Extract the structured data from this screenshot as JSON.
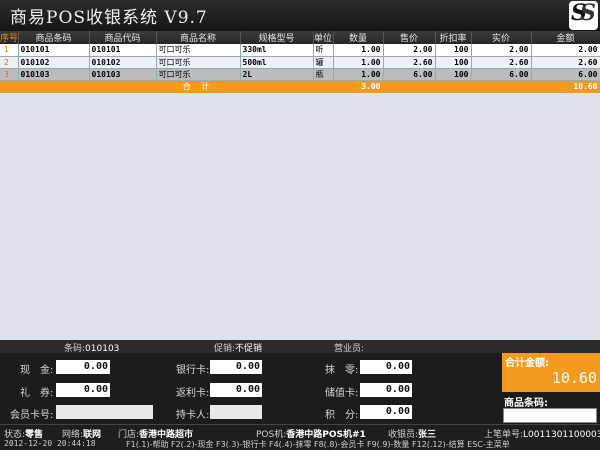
{
  "title": "商易POS收银系统 V9.7",
  "logo_text": "SS",
  "columns": [
    "序号",
    "商品条码",
    "商品代码",
    "商品名称",
    "规格型号",
    "单位",
    "数量",
    "售价",
    "折扣率",
    "实价",
    "金额"
  ],
  "rows": [
    {
      "idx": "1",
      "barcode": "010101",
      "code": "010101",
      "name": "可口可乐",
      "spec": "330ml",
      "unit": "听",
      "qty": "1.00",
      "price": "2.00",
      "discount": "100",
      "real": "2.00",
      "amount": "2.00"
    },
    {
      "idx": "2",
      "barcode": "010102",
      "code": "010102",
      "name": "可口可乐",
      "spec": "500ml",
      "unit": "罐",
      "qty": "1.00",
      "price": "2.60",
      "discount": "100",
      "real": "2.60",
      "amount": "2.60"
    },
    {
      "idx": "3",
      "barcode": "010103",
      "code": "010103",
      "name": "可口可乐",
      "spec": "2L",
      "unit": "瓶",
      "qty": "1.00",
      "price": "6.00",
      "discount": "100",
      "real": "6.00",
      "amount": "6.00"
    }
  ],
  "summary": {
    "label": "合 计",
    "qty": "3.00",
    "amount": "10.60"
  },
  "info_bar": {
    "barcode_label": "条码:",
    "barcode_value": "010103",
    "promo_label": "促销:",
    "promo_value": "不促销",
    "clerk_label": "营业员:",
    "clerk_value": ""
  },
  "payment": {
    "cash_label": "现　金:",
    "cash": "0.00",
    "bankcard_label": "银行卡:",
    "bankcard": "0.00",
    "change_label": "抹　零:",
    "change": "0.00",
    "coupon_label": "礼　券:",
    "coupon": "0.00",
    "rebate_label": "返利卡:",
    "rebate": "0.00",
    "stored_label": "储值卡:",
    "stored": "0.00",
    "member_label": "会员卡号:",
    "holder_label": "持卡人:",
    "points_label": "积　分:",
    "points": "0.00"
  },
  "total": {
    "label": "合计金额:",
    "amount": "10.60"
  },
  "barcode_input_label": "商品条码:",
  "status": {
    "state": "状态:",
    "state_value": "零售",
    "network": "网络:",
    "network_value": "联网",
    "store": "门店:",
    "store_value": "香港中路超市",
    "pos": "POS机:",
    "pos_value": "香港中路POS机#1",
    "cashier": "收银员:",
    "cashier_value": "张三",
    "last_order": "上笔单号:",
    "last_order_value": "L0011301100003",
    "datetime": "2012-12-20 20:44:18",
    "shortcuts": "F1(.1)-帮助 F2(.2)-现金 F3(.3)-银行卡 F4(.4)-抹零 F8(.8)-会员卡 F9(.9)-数量 F12(.12)-结算 ESC-主菜单"
  },
  "colors": {
    "accent": "#f39a1f",
    "header_bg": "#2c2c2c",
    "grid_bg": "#dde3e8"
  }
}
